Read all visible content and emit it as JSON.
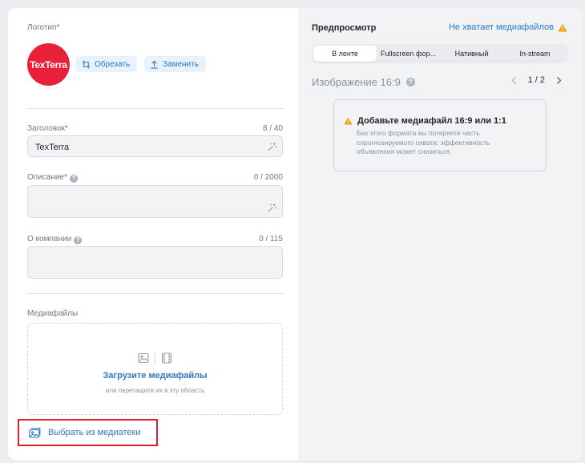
{
  "left": {
    "logo": {
      "label": "Логотип",
      "text": "TexTerra",
      "crop_label": "Обрезать",
      "replace_label": "Заменить"
    },
    "headline": {
      "label": "Заголовок",
      "counter": "8 / 40",
      "value": "TexTerra"
    },
    "description": {
      "label": "Описание",
      "counter": "0 / 2000",
      "value": ""
    },
    "about": {
      "label": "О компании",
      "counter": "0 / 115",
      "value": ""
    },
    "media": {
      "label": "Медиафайлы",
      "upload_title": "Загрузите медиафайлы",
      "upload_hint": "или перетащите их в эту область",
      "library_label": "Выбрать из медиатеки"
    }
  },
  "preview": {
    "title": "Предпросмотр",
    "missing_label": "Не хватает медиафайлов",
    "tabs": [
      {
        "label": "В ленте"
      },
      {
        "label": "Fullscreen фор..."
      },
      {
        "label": "Нативный"
      },
      {
        "label": "In-stream"
      }
    ],
    "image_title": "Изображение 16:9",
    "page_label": "1 / 2",
    "warning": {
      "title": "Добавьте медиафайл 16:9 или 1:1",
      "body": "Без этого формата вы потеряете часть спрогнозируемого охвата: эффективность объявления может снизиться."
    }
  },
  "colors": {
    "accent": "#2d79c7",
    "logo_bg": "#e8203a",
    "required": "#e64646",
    "warning": "#f0a10a",
    "highlight": "#e2202a"
  }
}
